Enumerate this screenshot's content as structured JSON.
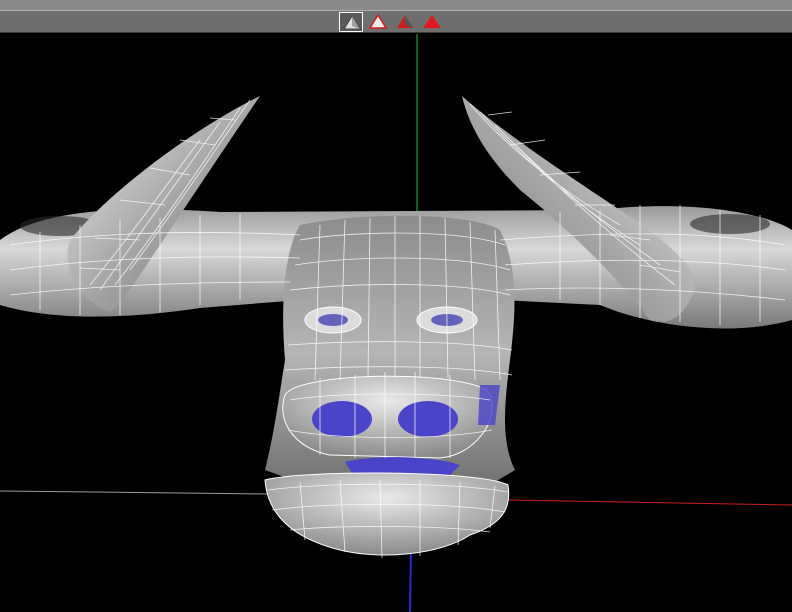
{
  "toolbar": {
    "buttons": [
      {
        "name": "shade-mode-smooth-wire",
        "icon": "shaded-wire-white-icon",
        "active": true
      },
      {
        "name": "shade-mode-outline",
        "icon": "outline-red-icon",
        "active": false
      },
      {
        "name": "shade-mode-flat-red",
        "icon": "flat-red-icon",
        "active": false
      },
      {
        "name": "shade-mode-solid-red",
        "icon": "solid-red-icon",
        "active": false
      }
    ]
  },
  "viewport": {
    "object": "bull-head-wireframe-mesh",
    "axes": {
      "x": "#cc1f1f",
      "y": "#1fbf3a",
      "z": "#2a2acc"
    },
    "colors": {
      "background": "#000000",
      "mesh": "#b9b9b9",
      "wire": "#ffffff",
      "interior": "#4a44c8"
    }
  }
}
